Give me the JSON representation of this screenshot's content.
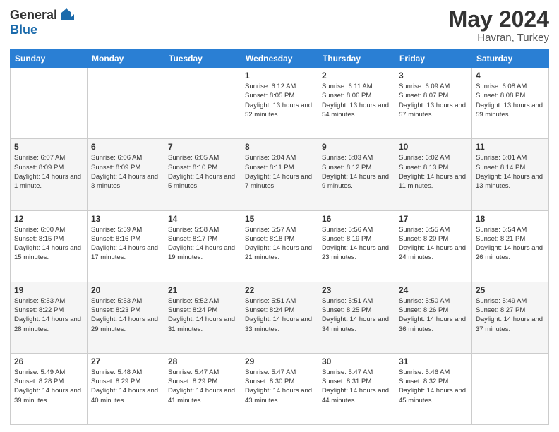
{
  "header": {
    "logo_general": "General",
    "logo_blue": "Blue",
    "month_year": "May 2024",
    "location": "Havran, Turkey"
  },
  "weekdays": [
    "Sunday",
    "Monday",
    "Tuesday",
    "Wednesday",
    "Thursday",
    "Friday",
    "Saturday"
  ],
  "weeks": [
    [
      null,
      null,
      null,
      {
        "day": "1",
        "sunrise": "6:12 AM",
        "sunset": "8:05 PM",
        "daylight": "13 hours and 52 minutes."
      },
      {
        "day": "2",
        "sunrise": "6:11 AM",
        "sunset": "8:06 PM",
        "daylight": "13 hours and 54 minutes."
      },
      {
        "day": "3",
        "sunrise": "6:09 AM",
        "sunset": "8:07 PM",
        "daylight": "13 hours and 57 minutes."
      },
      {
        "day": "4",
        "sunrise": "6:08 AM",
        "sunset": "8:08 PM",
        "daylight": "13 hours and 59 minutes."
      }
    ],
    [
      {
        "day": "5",
        "sunrise": "6:07 AM",
        "sunset": "8:09 PM",
        "daylight": "14 hours and 1 minute."
      },
      {
        "day": "6",
        "sunrise": "6:06 AM",
        "sunset": "8:09 PM",
        "daylight": "14 hours and 3 minutes."
      },
      {
        "day": "7",
        "sunrise": "6:05 AM",
        "sunset": "8:10 PM",
        "daylight": "14 hours and 5 minutes."
      },
      {
        "day": "8",
        "sunrise": "6:04 AM",
        "sunset": "8:11 PM",
        "daylight": "14 hours and 7 minutes."
      },
      {
        "day": "9",
        "sunrise": "6:03 AM",
        "sunset": "8:12 PM",
        "daylight": "14 hours and 9 minutes."
      },
      {
        "day": "10",
        "sunrise": "6:02 AM",
        "sunset": "8:13 PM",
        "daylight": "14 hours and 11 minutes."
      },
      {
        "day": "11",
        "sunrise": "6:01 AM",
        "sunset": "8:14 PM",
        "daylight": "14 hours and 13 minutes."
      }
    ],
    [
      {
        "day": "12",
        "sunrise": "6:00 AM",
        "sunset": "8:15 PM",
        "daylight": "14 hours and 15 minutes."
      },
      {
        "day": "13",
        "sunrise": "5:59 AM",
        "sunset": "8:16 PM",
        "daylight": "14 hours and 17 minutes."
      },
      {
        "day": "14",
        "sunrise": "5:58 AM",
        "sunset": "8:17 PM",
        "daylight": "14 hours and 19 minutes."
      },
      {
        "day": "15",
        "sunrise": "5:57 AM",
        "sunset": "8:18 PM",
        "daylight": "14 hours and 21 minutes."
      },
      {
        "day": "16",
        "sunrise": "5:56 AM",
        "sunset": "8:19 PM",
        "daylight": "14 hours and 23 minutes."
      },
      {
        "day": "17",
        "sunrise": "5:55 AM",
        "sunset": "8:20 PM",
        "daylight": "14 hours and 24 minutes."
      },
      {
        "day": "18",
        "sunrise": "5:54 AM",
        "sunset": "8:21 PM",
        "daylight": "14 hours and 26 minutes."
      }
    ],
    [
      {
        "day": "19",
        "sunrise": "5:53 AM",
        "sunset": "8:22 PM",
        "daylight": "14 hours and 28 minutes."
      },
      {
        "day": "20",
        "sunrise": "5:53 AM",
        "sunset": "8:23 PM",
        "daylight": "14 hours and 29 minutes."
      },
      {
        "day": "21",
        "sunrise": "5:52 AM",
        "sunset": "8:24 PM",
        "daylight": "14 hours and 31 minutes."
      },
      {
        "day": "22",
        "sunrise": "5:51 AM",
        "sunset": "8:24 PM",
        "daylight": "14 hours and 33 minutes."
      },
      {
        "day": "23",
        "sunrise": "5:51 AM",
        "sunset": "8:25 PM",
        "daylight": "14 hours and 34 minutes."
      },
      {
        "day": "24",
        "sunrise": "5:50 AM",
        "sunset": "8:26 PM",
        "daylight": "14 hours and 36 minutes."
      },
      {
        "day": "25",
        "sunrise": "5:49 AM",
        "sunset": "8:27 PM",
        "daylight": "14 hours and 37 minutes."
      }
    ],
    [
      {
        "day": "26",
        "sunrise": "5:49 AM",
        "sunset": "8:28 PM",
        "daylight": "14 hours and 39 minutes."
      },
      {
        "day": "27",
        "sunrise": "5:48 AM",
        "sunset": "8:29 PM",
        "daylight": "14 hours and 40 minutes."
      },
      {
        "day": "28",
        "sunrise": "5:47 AM",
        "sunset": "8:29 PM",
        "daylight": "14 hours and 41 minutes."
      },
      {
        "day": "29",
        "sunrise": "5:47 AM",
        "sunset": "8:30 PM",
        "daylight": "14 hours and 43 minutes."
      },
      {
        "day": "30",
        "sunrise": "5:47 AM",
        "sunset": "8:31 PM",
        "daylight": "14 hours and 44 minutes."
      },
      {
        "day": "31",
        "sunrise": "5:46 AM",
        "sunset": "8:32 PM",
        "daylight": "14 hours and 45 minutes."
      },
      null
    ]
  ],
  "labels": {
    "sunrise_prefix": "Sunrise: ",
    "sunset_prefix": "Sunset: ",
    "daylight_prefix": "Daylight: "
  }
}
